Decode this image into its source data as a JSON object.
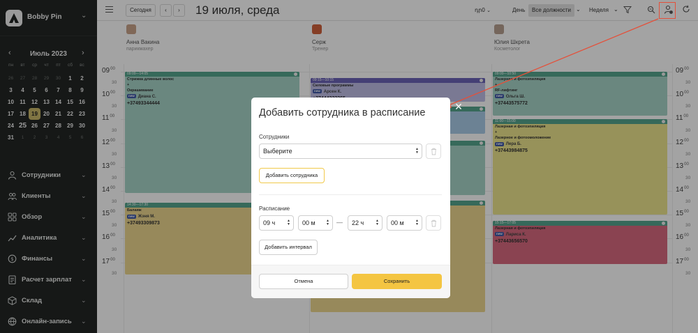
{
  "sidebar": {
    "company": "Bobby Pin",
    "calendar": {
      "month_label": "Июль 2023",
      "weekdays": [
        "пн",
        "вт",
        "ср",
        "чт",
        "пт",
        "сб",
        "вс"
      ],
      "days": [
        {
          "d": "26",
          "dim": true
        },
        {
          "d": "27",
          "dim": true
        },
        {
          "d": "28",
          "dim": true
        },
        {
          "d": "29",
          "dim": true
        },
        {
          "d": "30",
          "dim": true
        },
        {
          "d": "1"
        },
        {
          "d": "2"
        },
        {
          "d": "3"
        },
        {
          "d": "4"
        },
        {
          "d": "5"
        },
        {
          "d": "6"
        },
        {
          "d": "7"
        },
        {
          "d": "8"
        },
        {
          "d": "9"
        },
        {
          "d": "10"
        },
        {
          "d": "11"
        },
        {
          "d": "12"
        },
        {
          "d": "13"
        },
        {
          "d": "14"
        },
        {
          "d": "15"
        },
        {
          "d": "16"
        },
        {
          "d": "17"
        },
        {
          "d": "18"
        },
        {
          "d": "19",
          "today": true
        },
        {
          "d": "20"
        },
        {
          "d": "21"
        },
        {
          "d": "22"
        },
        {
          "d": "23"
        },
        {
          "d": "24"
        },
        {
          "d": "25",
          "big": true
        },
        {
          "d": "26"
        },
        {
          "d": "27"
        },
        {
          "d": "28"
        },
        {
          "d": "29"
        },
        {
          "d": "30"
        },
        {
          "d": "31"
        },
        {
          "d": "1",
          "dim": true
        },
        {
          "d": "2",
          "dim": true
        },
        {
          "d": "3",
          "dim": true
        },
        {
          "d": "4",
          "dim": true
        },
        {
          "d": "5",
          "dim": true
        },
        {
          "d": "6",
          "dim": true
        }
      ]
    },
    "menu": [
      {
        "label": "Сотрудники",
        "icon": "staff-icon"
      },
      {
        "label": "Клиенты",
        "icon": "clients-icon"
      },
      {
        "label": "Обзор",
        "icon": "overview-icon"
      },
      {
        "label": "Аналитика",
        "icon": "analytics-icon"
      },
      {
        "label": "Финансы",
        "icon": "finance-icon"
      },
      {
        "label": "Расчет зарплат",
        "icon": "payroll-icon"
      },
      {
        "label": "Склад",
        "icon": "warehouse-icon"
      },
      {
        "label": "Онлайн-запись",
        "icon": "online-booking-icon"
      }
    ]
  },
  "topbar": {
    "today_label": "Сегодня",
    "prev_icon": "‹",
    "next_icon": "›",
    "date_title": "19 июля, среда",
    "currency": "դր0",
    "day_label": "День",
    "positions_label": "Все должности",
    "week_label": "Неделя"
  },
  "staff": [
    {
      "name": "Анна Вакина",
      "role": "парикмахер",
      "avatar_color": "#c9a38a"
    },
    {
      "name": "Серж",
      "role": "Тренер",
      "avatar_color": "#d0623c"
    },
    {
      "name": "Юлия Шкрета",
      "role": "Косметолог",
      "avatar_color": "#b8a090"
    }
  ],
  "times": [
    "09",
    "10",
    "11",
    "12",
    "13",
    "14",
    "15",
    "16",
    "17"
  ],
  "minutes_label": "00",
  "half_label": "30",
  "appointments": [
    {
      "col": 0,
      "time": "09:00—14:05",
      "services": [
        "Стрижка длинные волос",
        "+",
        "Окрашивание"
      ],
      "tag": "new",
      "client": "Диана С.",
      "phone": "+37493344444",
      "bg": "#a6d3c7",
      "head": "#55a58d"
    },
    {
      "col": 0,
      "time": "14:30—17:30",
      "services": [
        "Балаяж"
      ],
      "tag": "new",
      "client": "Жэня М.",
      "phone": "+37493309873",
      "bg": "#ecd78f",
      "head": "#55a58d"
    },
    {
      "col": 1,
      "time": "09:15—10:15",
      "services": [
        "Силовые программы"
      ],
      "tag": "new",
      "client": "Арсен К.",
      "phone": "+37444333365",
      "bg": "#bfbde6",
      "head": "#6b63b8"
    },
    {
      "col": 1,
      "time": "",
      "services": [],
      "tag": "",
      "client": "",
      "phone": "",
      "bg": "#a9cbe8",
      "head": "#55a58d"
    },
    {
      "col": 1,
      "time": "",
      "services": [],
      "tag": "",
      "client": "",
      "phone": "",
      "bg": "#a6d3c7",
      "head": "#55a58d"
    },
    {
      "col": 1,
      "time": "",
      "services": [],
      "tag": "",
      "client": "",
      "phone": "",
      "bg": "#ecd78f",
      "head": "#55a58d"
    },
    {
      "col": 2,
      "time": "09:00—10:50",
      "services": [
        "Лазерная и фотоэпиляция",
        "+",
        "RF-лифтинг"
      ],
      "tag": "new",
      "client": "Ольга Ш.",
      "phone": "+37443575772",
      "bg": "#a6d3c7",
      "head": "#55a58d"
    },
    {
      "col": 2,
      "time": "11:00—15:00",
      "services": [
        "Лазерная и фотоэпиляция",
        "+",
        "Лазерное и фотоомоложение"
      ],
      "tag": "new",
      "client": "Лера Б.",
      "phone": "+37443984875",
      "bg": "#ece48d",
      "head": "#55a58d"
    },
    {
      "col": 2,
      "time": "15:15—17:05",
      "services": [
        "Лазерная и фотоэпиляция"
      ],
      "tag": "new",
      "client": "Лариса К.",
      "phone": "+37443656570",
      "bg": "#d86a7f",
      "head": "#55a58d"
    }
  ],
  "modal": {
    "title": "Добавить сотрудника в расписание",
    "staff_label": "Сотрудники",
    "staff_select_value": "Выберите",
    "add_staff_button": "Добавить сотрудника",
    "schedule_label": "Расписание",
    "from_hour": "09 ч",
    "from_min": "00 м",
    "dash": "—",
    "to_hour": "22 ч",
    "to_min": "00 м",
    "add_interval_button": "Добавить интервал",
    "cancel_button": "Отмена",
    "save_button": "Сохранить",
    "close_icon": "×"
  },
  "colors": {
    "sidebar_bg": "#232625",
    "accent_yellow": "#f4c542",
    "highlight_red": "#e4503a"
  }
}
